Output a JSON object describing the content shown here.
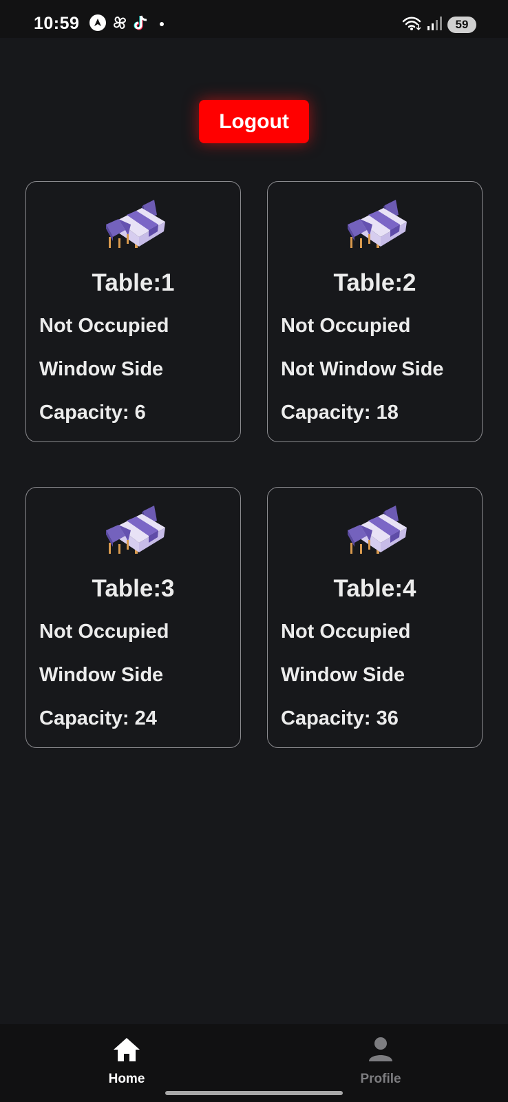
{
  "status_bar": {
    "time": "10:59",
    "battery": "59",
    "left_icons": [
      "nav-arrow-icon",
      "pinwheel-icon",
      "tiktok-icon",
      "notification-dot-icon"
    ],
    "right_icons": [
      "wifi-icon",
      "signal-icon",
      "battery-icon"
    ]
  },
  "logout": {
    "label": "Logout",
    "color": "#ff0000"
  },
  "tables": [
    {
      "title": "Table:1",
      "occupancy": "Not Occupied",
      "location": "Window Side",
      "capacity": "Capacity: 6"
    },
    {
      "title": "Table:2",
      "occupancy": "Not Occupied",
      "location": "Not Window Side",
      "capacity": "Capacity: 18"
    },
    {
      "title": "Table:3",
      "occupancy": "Not Occupied",
      "location": "Window Side",
      "capacity": "Capacity: 24"
    },
    {
      "title": "Table:4",
      "occupancy": "Not Occupied",
      "location": "Window Side",
      "capacity": "Capacity: 36"
    }
  ],
  "bottom_nav": {
    "items": [
      {
        "label": "Home",
        "icon": "home-icon",
        "active": true
      },
      {
        "label": "Profile",
        "icon": "person-icon",
        "active": false
      }
    ]
  }
}
